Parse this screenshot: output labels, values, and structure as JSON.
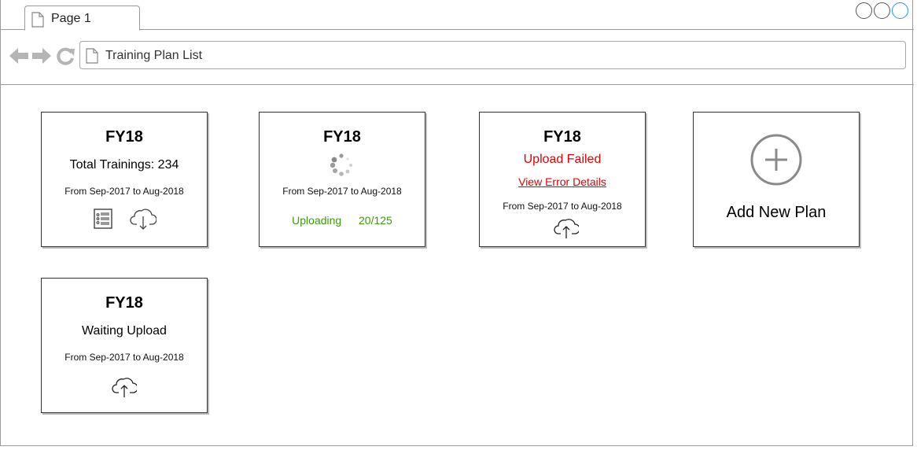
{
  "browser": {
    "tab_label": "Page 1",
    "address": "Training Plan List"
  },
  "cards": [
    {
      "title": "FY18",
      "summary": "Total Trainings: 234",
      "range": "From Sep-2017 to Aug-2018",
      "icons": [
        "list-icon",
        "cloud-download-icon"
      ]
    },
    {
      "title": "FY18",
      "range": "From Sep-2017 to Aug-2018",
      "status": "Uploading",
      "progress_text": "20/125",
      "icons": [
        "loading-spinner-icon"
      ]
    },
    {
      "title": "FY18",
      "status": "Upload Failed",
      "link": "View Error Details",
      "range": "From Sep-2017 to Aug-2018",
      "icons": [
        "cloud-upload-icon"
      ]
    },
    {
      "label": "Add New Plan",
      "icons": [
        "plus-circle-icon"
      ]
    },
    {
      "title": "FY18",
      "status": "Waiting Upload",
      "range": "From Sep-2017 to Aug-2018",
      "icons": [
        "cloud-upload-icon"
      ]
    }
  ],
  "colors": {
    "error": "#e30000",
    "success": "#3a9a0b",
    "active_window_control": "#1f9bd9"
  }
}
